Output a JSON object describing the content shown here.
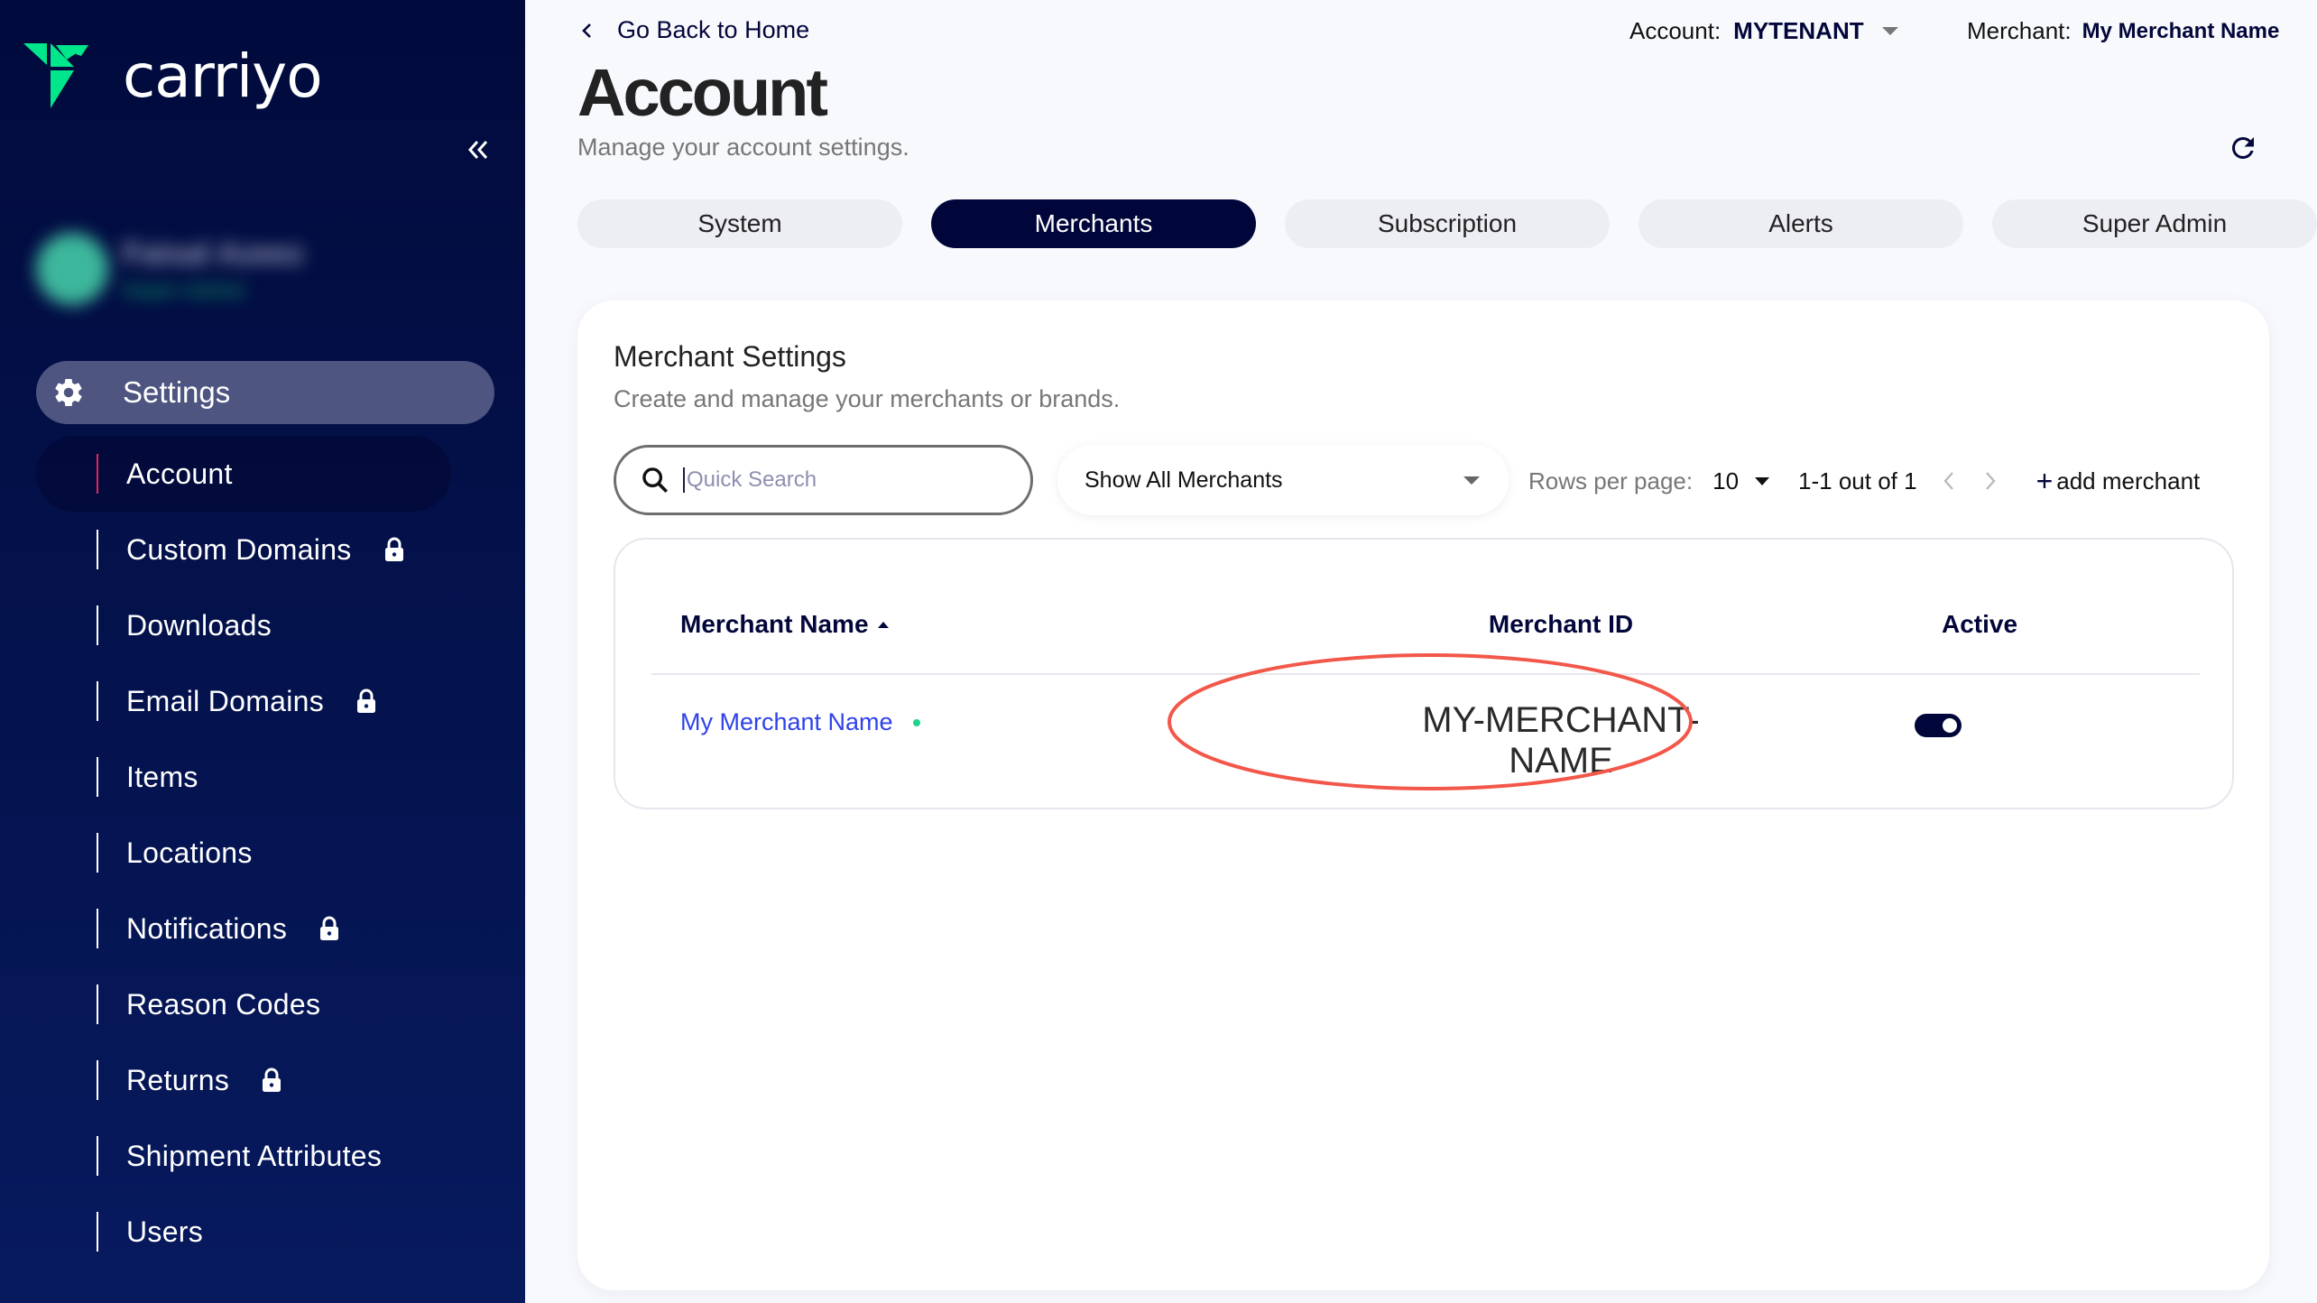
{
  "app": {
    "brand": "carriyo",
    "brand_color": "#00e68a",
    "sidebar_bg": "#010a3c"
  },
  "sidebar": {
    "collapse_icon": "double-chevron-left-icon",
    "user": {
      "name": "Faisal Azeez",
      "role": "Super Admin",
      "blurred": true
    },
    "section": {
      "label": "Settings",
      "icon": "gear-icon"
    },
    "items": [
      {
        "label": "Account",
        "active": true,
        "locked": false
      },
      {
        "label": "Custom Domains",
        "active": false,
        "locked": true
      },
      {
        "label": "Downloads",
        "active": false,
        "locked": false
      },
      {
        "label": "Email Domains",
        "active": false,
        "locked": true
      },
      {
        "label": "Items",
        "active": false,
        "locked": false
      },
      {
        "label": "Locations",
        "active": false,
        "locked": false
      },
      {
        "label": "Notifications",
        "active": false,
        "locked": true
      },
      {
        "label": "Reason Codes",
        "active": false,
        "locked": false
      },
      {
        "label": "Returns",
        "active": false,
        "locked": true
      },
      {
        "label": "Shipment Attributes",
        "active": false,
        "locked": false
      },
      {
        "label": "Users",
        "active": false,
        "locked": false
      }
    ]
  },
  "header": {
    "back_label": "Go Back to Home",
    "title": "Account",
    "subtitle": "Manage your account settings.",
    "account_label": "Account:",
    "account_value": "MYTENANT",
    "merchant_label": "Merchant:",
    "merchant_value": "My Merchant Name"
  },
  "tabs": [
    {
      "label": "System",
      "active": false
    },
    {
      "label": "Merchants",
      "active": true
    },
    {
      "label": "Subscription",
      "active": false
    },
    {
      "label": "Alerts",
      "active": false
    },
    {
      "label": "Super Admin",
      "active": false
    }
  ],
  "card": {
    "title": "Merchant Settings",
    "subtitle": "Create and manage your merchants or brands.",
    "search": {
      "placeholder": "Quick Search",
      "value": ""
    },
    "filter": {
      "selected": "Show All Merchants"
    },
    "pagination": {
      "rows_per_page_label": "Rows per page:",
      "rows_per_page": "10",
      "range": "1-1 out of 1"
    },
    "add_label": "add merchant",
    "table": {
      "columns": [
        "Merchant Name",
        "Merchant ID",
        "Active"
      ],
      "sort": {
        "column": "Merchant Name",
        "direction": "asc"
      },
      "rows": [
        {
          "name": "My Merchant Name",
          "status_dot": "#1ed38a",
          "id": "MY-MERCHANT-NAME",
          "active": true
        }
      ]
    },
    "annotation": {
      "shape": "ellipse",
      "color": "#f2574a",
      "target": "Merchant ID value"
    }
  }
}
